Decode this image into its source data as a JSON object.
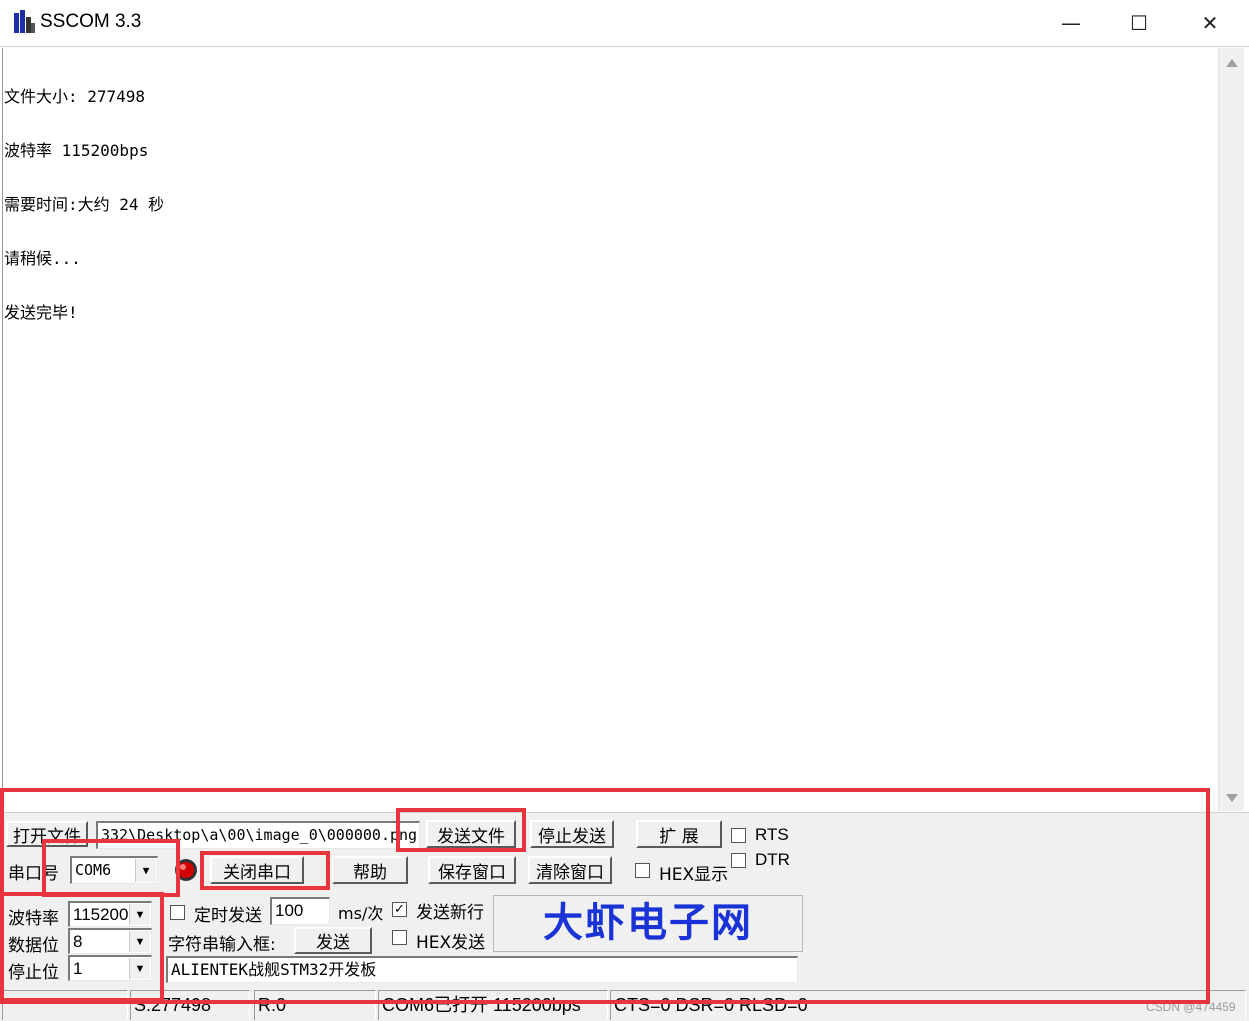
{
  "window": {
    "title": "SSCOM 3.3",
    "minimize_glyph": "—",
    "maximize_glyph": "☐",
    "close_glyph": "✕"
  },
  "receive": {
    "lines": [
      "文件大小: 277498",
      "波特率 115200bps",
      "需要时间:大约 24 秒",
      "请稍候...",
      "发送完毕!"
    ]
  },
  "toolbar": {
    "open_file": "打开文件",
    "file_path": "332\\Desktop\\a\\00\\image_0\\000000.png",
    "send_file": "发送文件",
    "stop_send": "停止发送",
    "expand": "扩 展",
    "rts_label": "RTS",
    "dtr_label": "DTR",
    "port_label": "串口号",
    "port_value": "COM6",
    "close_port": "关闭串口",
    "help": "帮助",
    "save_window": "保存窗口",
    "clear_window": "清除窗口",
    "hex_display": "HEX显示",
    "baud_label": "波特率",
    "baud_value": "115200",
    "databits_label": "数据位",
    "databits_value": "8",
    "stopbits_label": "停止位",
    "stopbits_value": "1",
    "timed_send": "定时发送",
    "interval_value": "100",
    "interval_unit": "ms/次",
    "send_newline": "发送新行",
    "send_newline_checked": true,
    "string_input_label": "字符串输入框:",
    "send": "发送",
    "hex_send": "HEX发送",
    "input_text": "ALIENTEK战舰STM32开发板",
    "logo_text": "大虾电子网"
  },
  "statusbar": {
    "sent": "S:277498",
    "received": "R:0",
    "port_status": "COM6已打开  115200bps",
    "lines_status": "CTS=0 DSR=0 RLSD=0"
  },
  "watermark": "CSDN @474459",
  "colors": {
    "highlight": "#e8343d",
    "logo": "#1a33d6"
  }
}
